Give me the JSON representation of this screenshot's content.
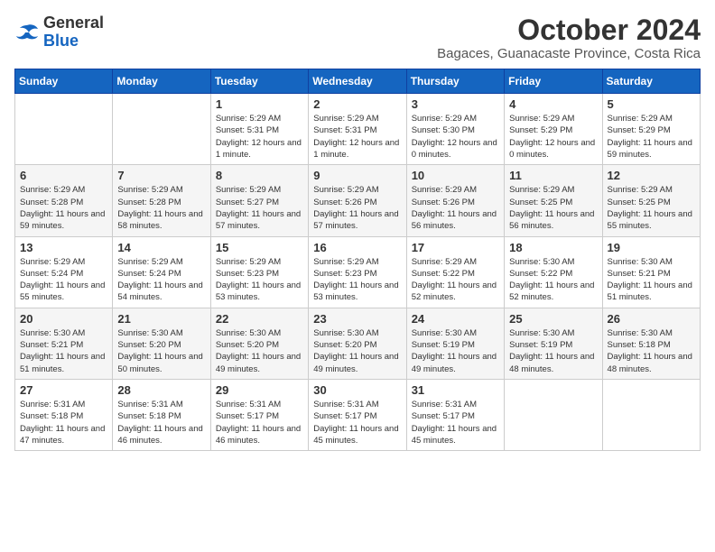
{
  "logo": {
    "line1": "General",
    "line2": "Blue"
  },
  "title": {
    "month_year": "October 2024",
    "location": "Bagaces, Guanacaste Province, Costa Rica"
  },
  "headers": [
    "Sunday",
    "Monday",
    "Tuesday",
    "Wednesday",
    "Thursday",
    "Friday",
    "Saturday"
  ],
  "weeks": [
    [
      {
        "day": "",
        "info": ""
      },
      {
        "day": "",
        "info": ""
      },
      {
        "day": "1",
        "info": "Sunrise: 5:29 AM\nSunset: 5:31 PM\nDaylight: 12 hours\nand 1 minute."
      },
      {
        "day": "2",
        "info": "Sunrise: 5:29 AM\nSunset: 5:31 PM\nDaylight: 12 hours\nand 1 minute."
      },
      {
        "day": "3",
        "info": "Sunrise: 5:29 AM\nSunset: 5:30 PM\nDaylight: 12 hours\nand 0 minutes."
      },
      {
        "day": "4",
        "info": "Sunrise: 5:29 AM\nSunset: 5:29 PM\nDaylight: 12 hours\nand 0 minutes."
      },
      {
        "day": "5",
        "info": "Sunrise: 5:29 AM\nSunset: 5:29 PM\nDaylight: 11 hours\nand 59 minutes."
      }
    ],
    [
      {
        "day": "6",
        "info": "Sunrise: 5:29 AM\nSunset: 5:28 PM\nDaylight: 11 hours\nand 59 minutes."
      },
      {
        "day": "7",
        "info": "Sunrise: 5:29 AM\nSunset: 5:28 PM\nDaylight: 11 hours\nand 58 minutes."
      },
      {
        "day": "8",
        "info": "Sunrise: 5:29 AM\nSunset: 5:27 PM\nDaylight: 11 hours\nand 57 minutes."
      },
      {
        "day": "9",
        "info": "Sunrise: 5:29 AM\nSunset: 5:26 PM\nDaylight: 11 hours\nand 57 minutes."
      },
      {
        "day": "10",
        "info": "Sunrise: 5:29 AM\nSunset: 5:26 PM\nDaylight: 11 hours\nand 56 minutes."
      },
      {
        "day": "11",
        "info": "Sunrise: 5:29 AM\nSunset: 5:25 PM\nDaylight: 11 hours\nand 56 minutes."
      },
      {
        "day": "12",
        "info": "Sunrise: 5:29 AM\nSunset: 5:25 PM\nDaylight: 11 hours\nand 55 minutes."
      }
    ],
    [
      {
        "day": "13",
        "info": "Sunrise: 5:29 AM\nSunset: 5:24 PM\nDaylight: 11 hours\nand 55 minutes."
      },
      {
        "day": "14",
        "info": "Sunrise: 5:29 AM\nSunset: 5:24 PM\nDaylight: 11 hours\nand 54 minutes."
      },
      {
        "day": "15",
        "info": "Sunrise: 5:29 AM\nSunset: 5:23 PM\nDaylight: 11 hours\nand 53 minutes."
      },
      {
        "day": "16",
        "info": "Sunrise: 5:29 AM\nSunset: 5:23 PM\nDaylight: 11 hours\nand 53 minutes."
      },
      {
        "day": "17",
        "info": "Sunrise: 5:29 AM\nSunset: 5:22 PM\nDaylight: 11 hours\nand 52 minutes."
      },
      {
        "day": "18",
        "info": "Sunrise: 5:30 AM\nSunset: 5:22 PM\nDaylight: 11 hours\nand 52 minutes."
      },
      {
        "day": "19",
        "info": "Sunrise: 5:30 AM\nSunset: 5:21 PM\nDaylight: 11 hours\nand 51 minutes."
      }
    ],
    [
      {
        "day": "20",
        "info": "Sunrise: 5:30 AM\nSunset: 5:21 PM\nDaylight: 11 hours\nand 51 minutes."
      },
      {
        "day": "21",
        "info": "Sunrise: 5:30 AM\nSunset: 5:20 PM\nDaylight: 11 hours\nand 50 minutes."
      },
      {
        "day": "22",
        "info": "Sunrise: 5:30 AM\nSunset: 5:20 PM\nDaylight: 11 hours\nand 49 minutes."
      },
      {
        "day": "23",
        "info": "Sunrise: 5:30 AM\nSunset: 5:20 PM\nDaylight: 11 hours\nand 49 minutes."
      },
      {
        "day": "24",
        "info": "Sunrise: 5:30 AM\nSunset: 5:19 PM\nDaylight: 11 hours\nand 49 minutes."
      },
      {
        "day": "25",
        "info": "Sunrise: 5:30 AM\nSunset: 5:19 PM\nDaylight: 11 hours\nand 48 minutes."
      },
      {
        "day": "26",
        "info": "Sunrise: 5:30 AM\nSunset: 5:18 PM\nDaylight: 11 hours\nand 48 minutes."
      }
    ],
    [
      {
        "day": "27",
        "info": "Sunrise: 5:31 AM\nSunset: 5:18 PM\nDaylight: 11 hours\nand 47 minutes."
      },
      {
        "day": "28",
        "info": "Sunrise: 5:31 AM\nSunset: 5:18 PM\nDaylight: 11 hours\nand 46 minutes."
      },
      {
        "day": "29",
        "info": "Sunrise: 5:31 AM\nSunset: 5:17 PM\nDaylight: 11 hours\nand 46 minutes."
      },
      {
        "day": "30",
        "info": "Sunrise: 5:31 AM\nSunset: 5:17 PM\nDaylight: 11 hours\nand 45 minutes."
      },
      {
        "day": "31",
        "info": "Sunrise: 5:31 AM\nSunset: 5:17 PM\nDaylight: 11 hours\nand 45 minutes."
      },
      {
        "day": "",
        "info": ""
      },
      {
        "day": "",
        "info": ""
      }
    ]
  ]
}
